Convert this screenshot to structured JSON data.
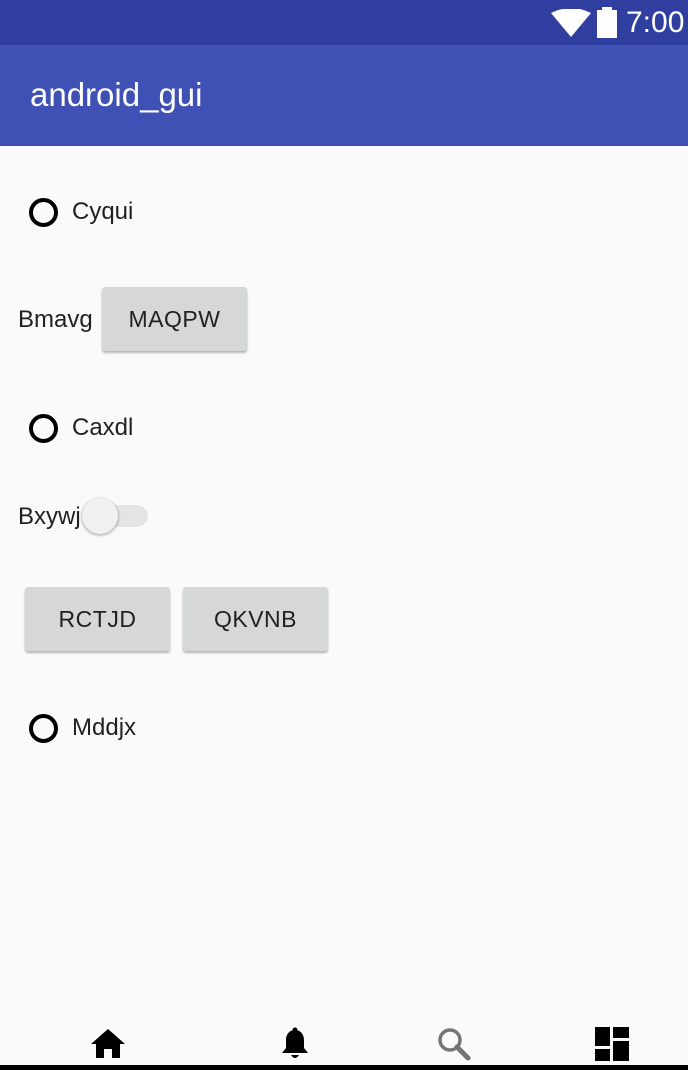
{
  "status_bar": {
    "time": "7:00",
    "icons": [
      "wifi-icon",
      "battery-icon"
    ],
    "color": "#303F9F"
  },
  "app_bar": {
    "title": "android_gui",
    "color": "#3F51B5"
  },
  "content": {
    "radio_1": {
      "label": "Cyqui",
      "checked": false
    },
    "row_bmavg": {
      "label": "Bmavg",
      "button": "MAQPW"
    },
    "radio_2": {
      "label": "Caxdl",
      "checked": false
    },
    "row_bxywj": {
      "label": "Bxywj",
      "switch_on": false
    },
    "buttons": [
      "RCTJD",
      "QKVNB"
    ],
    "radio_3": {
      "label": "Mddjx",
      "checked": false
    }
  },
  "bottom_nav": {
    "items": [
      "home-icon",
      "notifications-bell-icon",
      "search-icon",
      "dashboard-icon"
    ]
  }
}
